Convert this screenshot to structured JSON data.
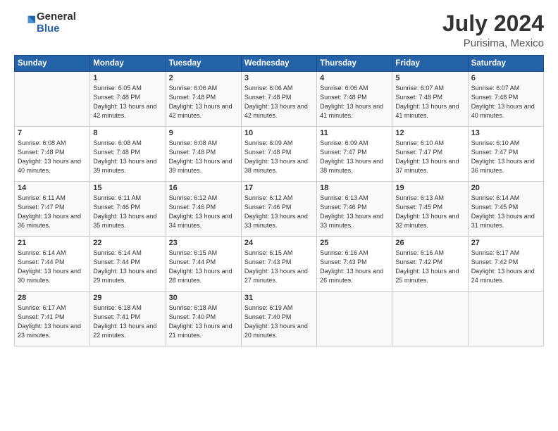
{
  "header": {
    "logo_general": "General",
    "logo_blue": "Blue",
    "title": "July 2024",
    "location": "Purisima, Mexico"
  },
  "days_of_week": [
    "Sunday",
    "Monday",
    "Tuesday",
    "Wednesday",
    "Thursday",
    "Friday",
    "Saturday"
  ],
  "weeks": [
    [
      {
        "day": "",
        "info": ""
      },
      {
        "day": "1",
        "info": "Sunrise: 6:05 AM\nSunset: 7:48 PM\nDaylight: 13 hours\nand 42 minutes."
      },
      {
        "day": "2",
        "info": "Sunrise: 6:06 AM\nSunset: 7:48 PM\nDaylight: 13 hours\nand 42 minutes."
      },
      {
        "day": "3",
        "info": "Sunrise: 6:06 AM\nSunset: 7:48 PM\nDaylight: 13 hours\nand 42 minutes."
      },
      {
        "day": "4",
        "info": "Sunrise: 6:06 AM\nSunset: 7:48 PM\nDaylight: 13 hours\nand 41 minutes."
      },
      {
        "day": "5",
        "info": "Sunrise: 6:07 AM\nSunset: 7:48 PM\nDaylight: 13 hours\nand 41 minutes."
      },
      {
        "day": "6",
        "info": "Sunrise: 6:07 AM\nSunset: 7:48 PM\nDaylight: 13 hours\nand 40 minutes."
      }
    ],
    [
      {
        "day": "7",
        "info": "Sunrise: 6:08 AM\nSunset: 7:48 PM\nDaylight: 13 hours\nand 40 minutes."
      },
      {
        "day": "8",
        "info": "Sunrise: 6:08 AM\nSunset: 7:48 PM\nDaylight: 13 hours\nand 39 minutes."
      },
      {
        "day": "9",
        "info": "Sunrise: 6:08 AM\nSunset: 7:48 PM\nDaylight: 13 hours\nand 39 minutes."
      },
      {
        "day": "10",
        "info": "Sunrise: 6:09 AM\nSunset: 7:48 PM\nDaylight: 13 hours\nand 38 minutes."
      },
      {
        "day": "11",
        "info": "Sunrise: 6:09 AM\nSunset: 7:47 PM\nDaylight: 13 hours\nand 38 minutes."
      },
      {
        "day": "12",
        "info": "Sunrise: 6:10 AM\nSunset: 7:47 PM\nDaylight: 13 hours\nand 37 minutes."
      },
      {
        "day": "13",
        "info": "Sunrise: 6:10 AM\nSunset: 7:47 PM\nDaylight: 13 hours\nand 36 minutes."
      }
    ],
    [
      {
        "day": "14",
        "info": "Sunrise: 6:11 AM\nSunset: 7:47 PM\nDaylight: 13 hours\nand 36 minutes."
      },
      {
        "day": "15",
        "info": "Sunrise: 6:11 AM\nSunset: 7:46 PM\nDaylight: 13 hours\nand 35 minutes."
      },
      {
        "day": "16",
        "info": "Sunrise: 6:12 AM\nSunset: 7:46 PM\nDaylight: 13 hours\nand 34 minutes."
      },
      {
        "day": "17",
        "info": "Sunrise: 6:12 AM\nSunset: 7:46 PM\nDaylight: 13 hours\nand 33 minutes."
      },
      {
        "day": "18",
        "info": "Sunrise: 6:13 AM\nSunset: 7:46 PM\nDaylight: 13 hours\nand 33 minutes."
      },
      {
        "day": "19",
        "info": "Sunrise: 6:13 AM\nSunset: 7:45 PM\nDaylight: 13 hours\nand 32 minutes."
      },
      {
        "day": "20",
        "info": "Sunrise: 6:14 AM\nSunset: 7:45 PM\nDaylight: 13 hours\nand 31 minutes."
      }
    ],
    [
      {
        "day": "21",
        "info": "Sunrise: 6:14 AM\nSunset: 7:44 PM\nDaylight: 13 hours\nand 30 minutes."
      },
      {
        "day": "22",
        "info": "Sunrise: 6:14 AM\nSunset: 7:44 PM\nDaylight: 13 hours\nand 29 minutes."
      },
      {
        "day": "23",
        "info": "Sunrise: 6:15 AM\nSunset: 7:44 PM\nDaylight: 13 hours\nand 28 minutes."
      },
      {
        "day": "24",
        "info": "Sunrise: 6:15 AM\nSunset: 7:43 PM\nDaylight: 13 hours\nand 27 minutes."
      },
      {
        "day": "25",
        "info": "Sunrise: 6:16 AM\nSunset: 7:43 PM\nDaylight: 13 hours\nand 26 minutes."
      },
      {
        "day": "26",
        "info": "Sunrise: 6:16 AM\nSunset: 7:42 PM\nDaylight: 13 hours\nand 25 minutes."
      },
      {
        "day": "27",
        "info": "Sunrise: 6:17 AM\nSunset: 7:42 PM\nDaylight: 13 hours\nand 24 minutes."
      }
    ],
    [
      {
        "day": "28",
        "info": "Sunrise: 6:17 AM\nSunset: 7:41 PM\nDaylight: 13 hours\nand 23 minutes."
      },
      {
        "day": "29",
        "info": "Sunrise: 6:18 AM\nSunset: 7:41 PM\nDaylight: 13 hours\nand 22 minutes."
      },
      {
        "day": "30",
        "info": "Sunrise: 6:18 AM\nSunset: 7:40 PM\nDaylight: 13 hours\nand 21 minutes."
      },
      {
        "day": "31",
        "info": "Sunrise: 6:19 AM\nSunset: 7:40 PM\nDaylight: 13 hours\nand 20 minutes."
      },
      {
        "day": "",
        "info": ""
      },
      {
        "day": "",
        "info": ""
      },
      {
        "day": "",
        "info": ""
      }
    ]
  ]
}
